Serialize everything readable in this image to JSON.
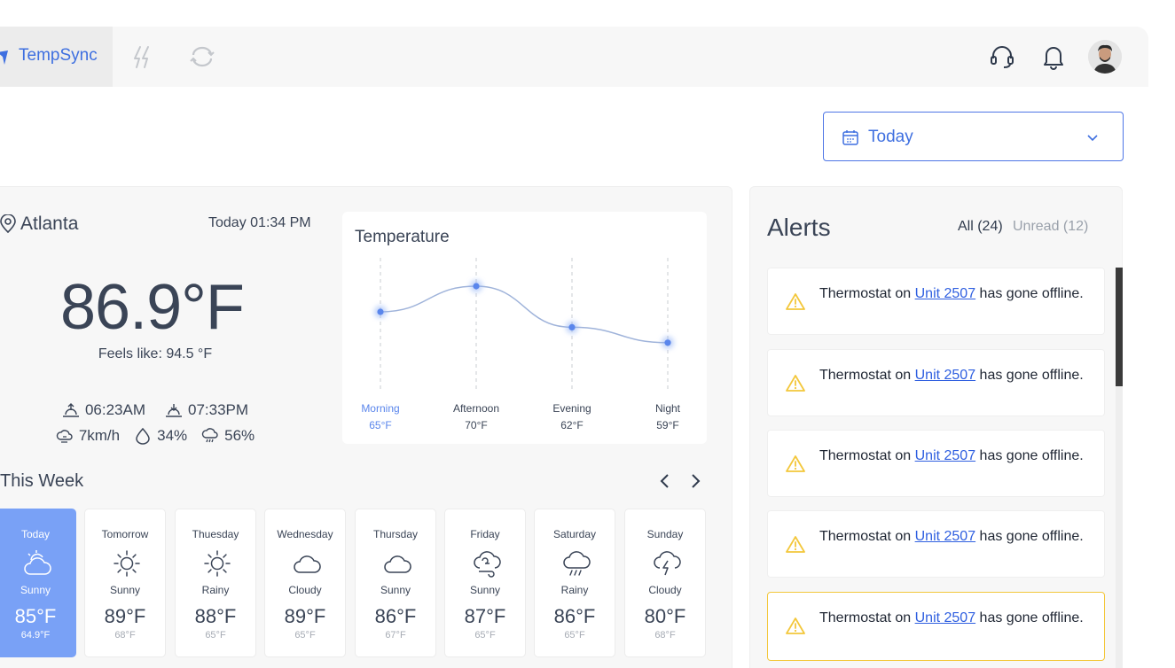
{
  "brand": {
    "name": "TempSync"
  },
  "header": {
    "icons": [
      "bolt-icon",
      "sync-icon",
      "headset-icon",
      "bell-icon",
      "avatar"
    ]
  },
  "date_filter": {
    "value": "Today"
  },
  "location": {
    "city": "Atlanta",
    "datetime": "Today 01:34 PM",
    "temperature": "86.9°F",
    "feels_like": "Feels like: 94.5 °F",
    "sunrise": "06:23AM",
    "sunset": "07:33PM",
    "wind": "7km/h",
    "humidity": "34%",
    "precipitation": "56%"
  },
  "temperature_card": {
    "title": "Temperature",
    "chart_data": {
      "type": "line",
      "categories": [
        "Morning",
        "Afternoon",
        "Evening",
        "Night"
      ],
      "values": [
        65,
        70,
        62,
        59
      ],
      "value_labels": [
        "65°F",
        "70°F",
        "62°F",
        "59°F"
      ],
      "title": "Temperature",
      "ylim": [
        50,
        75
      ],
      "grid": "vertical-dashed",
      "active_index": 0
    }
  },
  "week": {
    "title": "This Week",
    "days": [
      {
        "name": "Today",
        "condition": "Sunny",
        "high": "85°F",
        "low": "64.9°F",
        "icon": "partly-cloudy-icon",
        "active": true
      },
      {
        "name": "Tomorrow",
        "condition": "Sunny",
        "high": "89°F",
        "low": "68°F",
        "icon": "sun-icon"
      },
      {
        "name": "Thuesday",
        "condition": "Rainy",
        "high": "88°F",
        "low": "65°F",
        "icon": "sun-icon"
      },
      {
        "name": "Wednesday",
        "condition": "Cloudy",
        "high": "89°F",
        "low": "65°F",
        "icon": "cloud-icon"
      },
      {
        "name": "Thursday",
        "condition": "Sunny",
        "high": "86°F",
        "low": "67°F",
        "icon": "cloud-icon"
      },
      {
        "name": "Friday",
        "condition": "Sunny",
        "high": "87°F",
        "low": "65°F",
        "icon": "windy-cloud-icon"
      },
      {
        "name": "Saturday",
        "condition": "Rainy",
        "high": "86°F",
        "low": "65°F",
        "icon": "rain-cloud-icon"
      },
      {
        "name": "Sunday",
        "condition": "Cloudy",
        "high": "80°F",
        "low": "68°F",
        "icon": "storm-cloud-icon"
      }
    ]
  },
  "alerts": {
    "title": "Alerts",
    "filter_all": "All (24)",
    "filter_unread": "Unread (12)",
    "items": [
      {
        "prefix": "Thermostat on ",
        "link": "Unit 2507",
        "suffix": " has gone offline."
      },
      {
        "prefix": "Thermostat on ",
        "link": "Unit 2507",
        "suffix": " has gone offline."
      },
      {
        "prefix": "Thermostat on ",
        "link": "Unit 2507",
        "suffix": " has gone offline."
      },
      {
        "prefix": "Thermostat on ",
        "link": "Unit 2507",
        "suffix": " has gone offline."
      },
      {
        "prefix": "Thermostat on ",
        "link": "Unit 2507",
        "suffix": " has gone offline.",
        "highlight": true
      }
    ]
  },
  "colors": {
    "accent": "#3e6fe0",
    "active_day": "#79a1f6",
    "warning": "#f3c73b",
    "panel": "#f7f7f7"
  }
}
